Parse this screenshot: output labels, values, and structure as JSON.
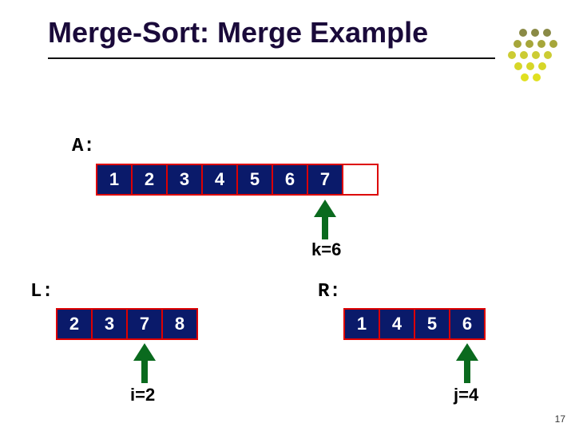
{
  "title": "Merge-Sort: Merge Example",
  "labels": {
    "A": "A:",
    "L": "L:",
    "R": "R:"
  },
  "A": [
    "1",
    "2",
    "3",
    "4",
    "5",
    "6",
    "7",
    ""
  ],
  "L": [
    "2",
    "3",
    "7",
    "8"
  ],
  "R": [
    "1",
    "4",
    "5",
    "6"
  ],
  "pointers": {
    "k": "k=6",
    "i": "i=2",
    "j": "j=4"
  },
  "slide": "17"
}
